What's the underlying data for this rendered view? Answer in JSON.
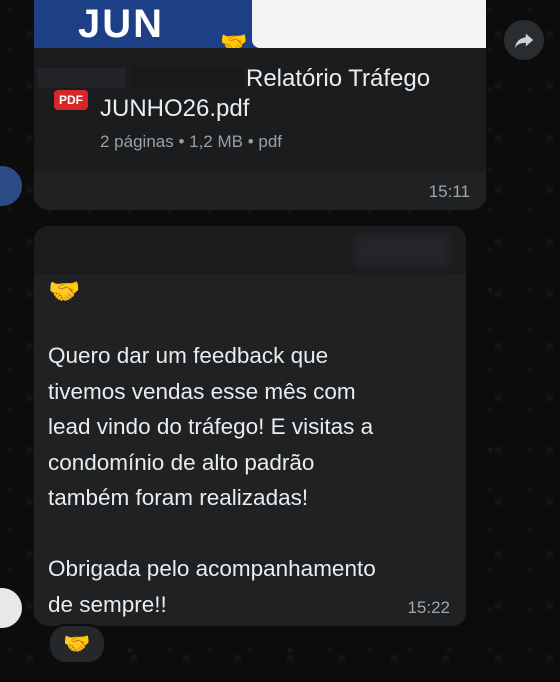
{
  "file_message": {
    "thumbnail_text": "JUN",
    "thumbnail_emoji": "🤝",
    "file_icon_label": "PDF",
    "file_name_line1": "Relatório Tráfego",
    "file_name_line2": "JUNHO26.pdf",
    "file_meta": "2 páginas • 1,2 MB • pdf",
    "time": "15:11"
  },
  "text_message": {
    "emoji": "🤝",
    "lines": [
      "Quero dar um feedback que",
      "tivemos vendas esse mês com",
      "lead vindo do tráfego! E visitas a",
      "condomínio de alto padrão",
      "também foram realizadas!"
    ],
    "lines2": [
      "Obrigada pelo acompanhamento",
      "de sempre!!"
    ],
    "time": "15:22",
    "reaction": "🤝"
  },
  "icons": {
    "forward": "forward-icon",
    "pdf": "pdf-icon"
  }
}
